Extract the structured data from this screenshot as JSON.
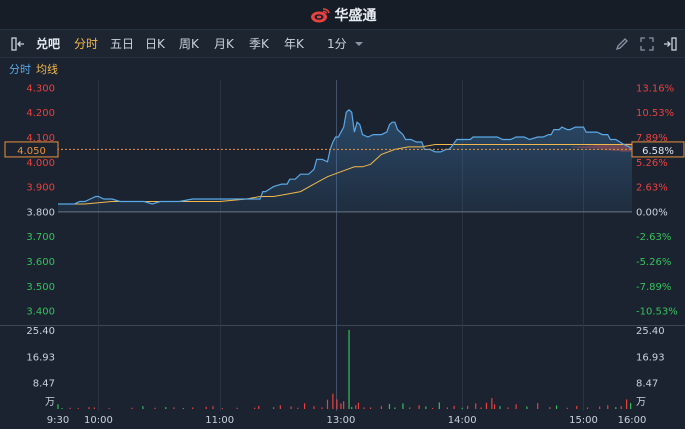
{
  "app": {
    "brand": "华盛通"
  },
  "toolbar": {
    "stock_name": "兑吧",
    "tabs": [
      "分时",
      "五日",
      "日K",
      "周K",
      "月K",
      "季K",
      "年K"
    ],
    "active_tab": "分时",
    "interval": "1分"
  },
  "legend": {
    "timeshare": "分时",
    "avg": "均线"
  },
  "colors": {
    "up": "#e8413f",
    "down": "#35c15c",
    "price_line": "#5aa9e6",
    "avg_line": "#f2b84b",
    "current": "#e8933b"
  },
  "current": {
    "price_tag": "4.050",
    "pct_tag": "6.58%"
  },
  "volume_unit": "万",
  "chart_data": {
    "type": "line",
    "title": "",
    "x": [
      "9:30",
      "10:00",
      "11:00",
      "13:00",
      "14:00",
      "15:00",
      "16:00"
    ],
    "price_ticks_left": [
      "4.300",
      "4.200",
      "4.100",
      "4.000",
      "3.900",
      "3.800",
      "3.700",
      "3.600",
      "3.500",
      "3.400"
    ],
    "pct_ticks_right": [
      "13.16%",
      "10.53%",
      "7.89%",
      "5.26%",
      "2.63%",
      "0.00%",
      "-2.63%",
      "-5.26%",
      "-7.89%",
      "-10.53%"
    ],
    "volume_ticks": [
      "25.40",
      "16.93",
      "8.47"
    ],
    "prev_close": 3.8,
    "ylim": [
      3.35,
      4.33
    ],
    "volume_max": 25.4,
    "series": [
      {
        "name": "分时",
        "points": [
          [
            0,
            3.83
          ],
          [
            4,
            3.83
          ],
          [
            8,
            3.83
          ],
          [
            12,
            3.83
          ],
          [
            16,
            3.84
          ],
          [
            20,
            3.84
          ],
          [
            24,
            3.85
          ],
          [
            28,
            3.86
          ],
          [
            30,
            3.86
          ],
          [
            34,
            3.85
          ],
          [
            40,
            3.85
          ],
          [
            46,
            3.84
          ],
          [
            50,
            3.84
          ],
          [
            56,
            3.84
          ],
          [
            60,
            3.84
          ],
          [
            64,
            3.84
          ],
          [
            70,
            3.83
          ],
          [
            76,
            3.84
          ],
          [
            82,
            3.84
          ],
          [
            90,
            3.84
          ],
          [
            100,
            3.85
          ],
          [
            110,
            3.85
          ],
          [
            120,
            3.85
          ],
          [
            130,
            3.85
          ],
          [
            140,
            3.85
          ],
          [
            150,
            3.85
          ],
          [
            152,
            3.88
          ],
          [
            154,
            3.88
          ],
          [
            160,
            3.9
          ],
          [
            166,
            3.91
          ],
          [
            170,
            3.91
          ],
          [
            172,
            3.93
          ],
          [
            176,
            3.93
          ],
          [
            180,
            3.95
          ],
          [
            186,
            3.95
          ],
          [
            190,
            3.97
          ],
          [
            192,
            4.01
          ],
          [
            196,
            4.01
          ],
          [
            200,
            4.0
          ],
          [
            202,
            4.05
          ],
          [
            204,
            4.08
          ],
          [
            206,
            4.1
          ],
          [
            208,
            4.1
          ],
          [
            210,
            4.12
          ],
          [
            212,
            4.14
          ],
          [
            214,
            4.2
          ],
          [
            216,
            4.21
          ],
          [
            218,
            4.2
          ],
          [
            220,
            4.12
          ],
          [
            222,
            4.16
          ],
          [
            224,
            4.15
          ],
          [
            226,
            4.11
          ],
          [
            230,
            4.1
          ],
          [
            234,
            4.11
          ],
          [
            238,
            4.11
          ],
          [
            240,
            4.11
          ],
          [
            244,
            4.12
          ],
          [
            246,
            4.15
          ],
          [
            248,
            4.16
          ],
          [
            250,
            4.16
          ],
          [
            252,
            4.13
          ],
          [
            256,
            4.11
          ],
          [
            258,
            4.09
          ],
          [
            262,
            4.09
          ],
          [
            266,
            4.08
          ],
          [
            270,
            4.08
          ],
          [
            272,
            4.05
          ],
          [
            276,
            4.05
          ],
          [
            280,
            4.04
          ],
          [
            284,
            4.04
          ],
          [
            288,
            4.05
          ],
          [
            290,
            4.05
          ],
          [
            292,
            4.06
          ],
          [
            296,
            4.09
          ],
          [
            300,
            4.09
          ],
          [
            306,
            4.09
          ],
          [
            308,
            4.1
          ],
          [
            314,
            4.1
          ],
          [
            320,
            4.1
          ],
          [
            326,
            4.1
          ],
          [
            330,
            4.09
          ],
          [
            336,
            4.09
          ],
          [
            340,
            4.1
          ],
          [
            346,
            4.1
          ],
          [
            350,
            4.09
          ],
          [
            356,
            4.1
          ],
          [
            360,
            4.1
          ],
          [
            364,
            4.11
          ],
          [
            366,
            4.11
          ],
          [
            368,
            4.13
          ],
          [
            372,
            4.13
          ],
          [
            374,
            4.14
          ],
          [
            378,
            4.13
          ],
          [
            380,
            4.13
          ],
          [
            384,
            4.14
          ],
          [
            390,
            4.14
          ],
          [
            392,
            4.12
          ],
          [
            396,
            4.12
          ],
          [
            400,
            4.12
          ],
          [
            404,
            4.11
          ],
          [
            408,
            4.11
          ],
          [
            410,
            4.09
          ],
          [
            414,
            4.09
          ],
          [
            420,
            4.07
          ],
          [
            424,
            4.06
          ],
          [
            426,
            4.05
          ]
        ]
      },
      {
        "name": "均线",
        "points": [
          [
            0,
            3.83
          ],
          [
            20,
            3.83
          ],
          [
            40,
            3.84
          ],
          [
            60,
            3.84
          ],
          [
            80,
            3.84
          ],
          [
            100,
            3.84
          ],
          [
            120,
            3.84
          ],
          [
            140,
            3.85
          ],
          [
            150,
            3.86
          ],
          [
            160,
            3.86
          ],
          [
            170,
            3.87
          ],
          [
            180,
            3.88
          ],
          [
            190,
            3.91
          ],
          [
            200,
            3.94
          ],
          [
            210,
            3.96
          ],
          [
            220,
            3.98
          ],
          [
            226,
            3.98
          ],
          [
            232,
            3.99
          ],
          [
            238,
            4.02
          ],
          [
            240,
            4.03
          ],
          [
            250,
            4.05
          ],
          [
            260,
            4.06
          ],
          [
            270,
            4.06
          ],
          [
            280,
            4.07
          ],
          [
            300,
            4.07
          ],
          [
            320,
            4.07
          ],
          [
            340,
            4.07
          ],
          [
            360,
            4.07
          ],
          [
            380,
            4.07
          ],
          [
            400,
            4.07
          ],
          [
            420,
            4.07
          ],
          [
            426,
            4.07
          ]
        ]
      }
    ],
    "volume": [
      {
        "t": 0,
        "v": 1.5,
        "c": "down"
      },
      {
        "t": 3,
        "v": 0.3,
        "c": "down"
      },
      {
        "t": 9,
        "v": 0.4,
        "c": "up"
      },
      {
        "t": 15,
        "v": 0.3,
        "c": "up"
      },
      {
        "t": 23,
        "v": 0.6,
        "c": "up"
      },
      {
        "t": 27,
        "v": 0.5,
        "c": "up"
      },
      {
        "t": 38,
        "v": 0.3,
        "c": "up"
      },
      {
        "t": 55,
        "v": 0.4,
        "c": "up"
      },
      {
        "t": 63,
        "v": 0.9,
        "c": "down"
      },
      {
        "t": 72,
        "v": 0.4,
        "c": "up"
      },
      {
        "t": 80,
        "v": 0.6,
        "c": "down"
      },
      {
        "t": 86,
        "v": 0.5,
        "c": "up"
      },
      {
        "t": 93,
        "v": 0.3,
        "c": "down"
      },
      {
        "t": 100,
        "v": 0.5,
        "c": "up"
      },
      {
        "t": 110,
        "v": 0.7,
        "c": "up"
      },
      {
        "t": 115,
        "v": 0.9,
        "c": "up"
      },
      {
        "t": 122,
        "v": 0.3,
        "c": "up"
      },
      {
        "t": 133,
        "v": 0.4,
        "c": "up"
      },
      {
        "t": 146,
        "v": 0.4,
        "c": "up"
      },
      {
        "t": 149,
        "v": 1.0,
        "c": "up"
      },
      {
        "t": 160,
        "v": 0.6,
        "c": "up"
      },
      {
        "t": 165,
        "v": 1.2,
        "c": "up"
      },
      {
        "t": 173,
        "v": 0.8,
        "c": "up"
      },
      {
        "t": 178,
        "v": 0.4,
        "c": "up"
      },
      {
        "t": 183,
        "v": 1.8,
        "c": "up"
      },
      {
        "t": 190,
        "v": 0.9,
        "c": "up"
      },
      {
        "t": 196,
        "v": 0.5,
        "c": "up"
      },
      {
        "t": 200,
        "v": 3.0,
        "c": "up"
      },
      {
        "t": 204,
        "v": 4.9,
        "c": "up"
      },
      {
        "t": 207,
        "v": 3.1,
        "c": "up"
      },
      {
        "t": 210,
        "v": 1.8,
        "c": "up"
      },
      {
        "t": 212,
        "v": 2.5,
        "c": "up"
      },
      {
        "t": 216,
        "v": 25.4,
        "c": "down"
      },
      {
        "t": 218,
        "v": 0.6,
        "c": "down"
      },
      {
        "t": 221,
        "v": 1.2,
        "c": "up"
      },
      {
        "t": 223,
        "v": 2.0,
        "c": "up"
      },
      {
        "t": 227,
        "v": 0.5,
        "c": "up"
      },
      {
        "t": 232,
        "v": 0.5,
        "c": "up"
      },
      {
        "t": 240,
        "v": 0.9,
        "c": "up"
      },
      {
        "t": 246,
        "v": 1.6,
        "c": "down"
      },
      {
        "t": 250,
        "v": 0.5,
        "c": "down"
      },
      {
        "t": 256,
        "v": 1.8,
        "c": "down"
      },
      {
        "t": 261,
        "v": 0.5,
        "c": "up"
      },
      {
        "t": 268,
        "v": 1.2,
        "c": "up"
      },
      {
        "t": 273,
        "v": 0.8,
        "c": "down"
      },
      {
        "t": 278,
        "v": 0.3,
        "c": "up"
      },
      {
        "t": 283,
        "v": 2.1,
        "c": "down"
      },
      {
        "t": 289,
        "v": 0.5,
        "c": "up"
      },
      {
        "t": 294,
        "v": 1.0,
        "c": "up"
      },
      {
        "t": 300,
        "v": 0.4,
        "c": "down"
      },
      {
        "t": 304,
        "v": 1.0,
        "c": "up"
      },
      {
        "t": 310,
        "v": 1.8,
        "c": "up"
      },
      {
        "t": 314,
        "v": 0.5,
        "c": "up"
      },
      {
        "t": 318,
        "v": 2.0,
        "c": "up"
      },
      {
        "t": 322,
        "v": 3.5,
        "c": "up"
      },
      {
        "t": 324,
        "v": 1.5,
        "c": "up"
      },
      {
        "t": 328,
        "v": 0.9,
        "c": "down"
      },
      {
        "t": 334,
        "v": 0.5,
        "c": "up"
      },
      {
        "t": 340,
        "v": 1.5,
        "c": "up"
      },
      {
        "t": 348,
        "v": 0.8,
        "c": "down"
      },
      {
        "t": 356,
        "v": 1.9,
        "c": "up"
      },
      {
        "t": 365,
        "v": 0.6,
        "c": "up"
      },
      {
        "t": 370,
        "v": 1.1,
        "c": "down"
      },
      {
        "t": 378,
        "v": 0.4,
        "c": "up"
      },
      {
        "t": 385,
        "v": 1.0,
        "c": "up"
      },
      {
        "t": 393,
        "v": 0.5,
        "c": "up"
      },
      {
        "t": 402,
        "v": 0.8,
        "c": "up"
      },
      {
        "t": 408,
        "v": 1.2,
        "c": "up"
      },
      {
        "t": 414,
        "v": 0.6,
        "c": "down"
      },
      {
        "t": 418,
        "v": 0.9,
        "c": "up"
      },
      {
        "t": 422,
        "v": 3.1,
        "c": "up"
      },
      {
        "t": 425,
        "v": 1.9,
        "c": "down"
      }
    ]
  }
}
